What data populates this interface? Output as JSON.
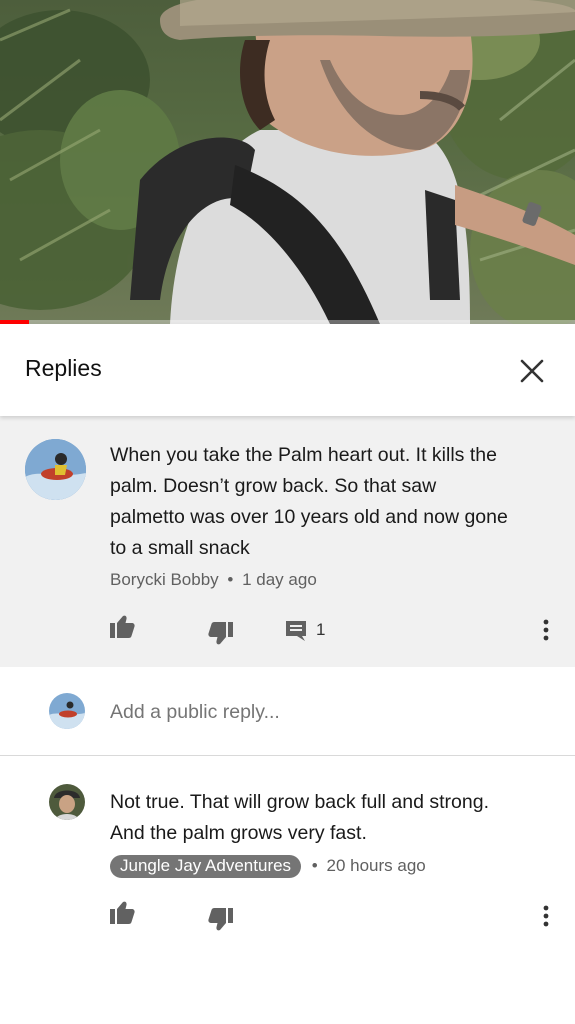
{
  "video": {
    "progress": 0.05,
    "progress_color": "#ff0000"
  },
  "header": {
    "title": "Replies",
    "close_icon": "close-icon"
  },
  "parent_comment": {
    "text_lines": [
      "When you take the Palm heart out. It kills the",
      "palm. Doesn’t grow back. So that saw",
      "palmetto was over 10 years old and now gone",
      "to a small snack"
    ],
    "author": "Borycki Bobby",
    "separator": "•",
    "time": "1 day ago",
    "reply_count": "1"
  },
  "add_reply": {
    "placeholder": "Add a public reply..."
  },
  "reply": {
    "text_lines": [
      "Not true. That will grow back full and strong.",
      "And the palm grows very fast."
    ],
    "author": "Jungle Jay Adventures",
    "separator": "•",
    "time": "20 hours ago"
  },
  "colors": {
    "parent_bg": "#f1f1f1",
    "icon": "#616161",
    "owner_chip": "#757575"
  }
}
